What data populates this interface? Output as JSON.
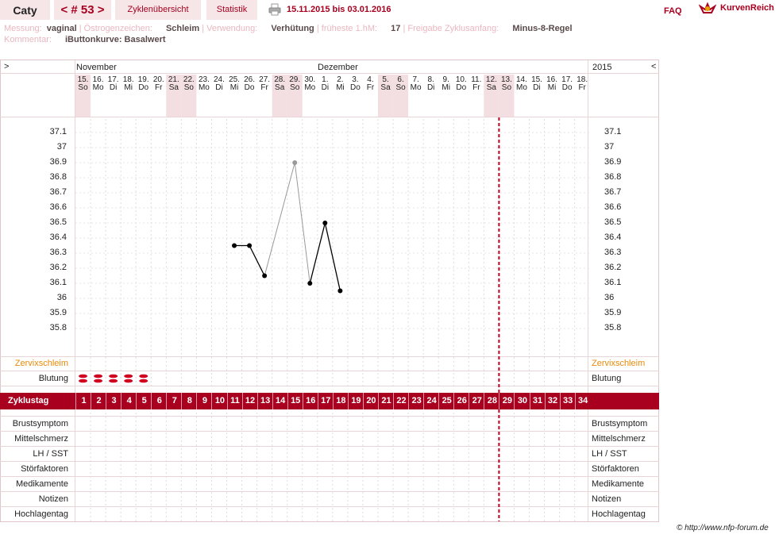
{
  "topbar": {
    "name": "Caty",
    "cycle_label": "< # 53 >",
    "tab_overview": "Zyklenübersicht",
    "tab_stats": "Statistik",
    "date_range": "15.11.2015 bis 03.01.2016",
    "faq": "FAQ",
    "logo": "KurvenReich"
  },
  "meta": {
    "messung_label": "Messung:",
    "messung_value": "vaginal",
    "oestrogen_label": "Östrogenzeichen:",
    "oestrogen_value": "Schleim",
    "verwendung_label": "Verwendung:",
    "verwendung_value": "Verhütung",
    "fruehste_label": "früheste 1.hM:",
    "fruehste_value": "17",
    "freigabe_label": "Freigabe Zyklusanfang:",
    "freigabe_value": "Minus-8-Regel",
    "kommentar_label": "Kommentar:",
    "kommentar_value": "iButtonkurve: Basalwert"
  },
  "chart": {
    "nav_left": ">",
    "nav_right": "<",
    "month_nov": "November",
    "month_dec": "Dezember",
    "year": "2015",
    "zervix_label": "Zervixschleim",
    "blutung_label": "Blutung",
    "zyklustag_label": "Zyklustag",
    "row_labels": [
      "Brustsymptom",
      "Mittelschmerz",
      "LH / SST",
      "Störfaktoren",
      "Medikamente",
      "Notizen",
      "Hochlagentag"
    ],
    "footer_credit": "© http://www.nfp-forum.de",
    "colors": {
      "accent": "#a8001e",
      "weekend": "#f3dfe2",
      "zervix": "#e98a0a",
      "coverline": "#c0001e"
    }
  },
  "chart_data": {
    "type": "line",
    "title": "",
    "ylabel": "",
    "ylim": [
      35.75,
      37.15
    ],
    "yticks": [
      "37.1",
      "37",
      "36.9",
      "36.8",
      "36.7",
      "36.6",
      "36.5",
      "36.4",
      "36.3",
      "36.2",
      "36.1",
      "36",
      "35.9",
      "35.8"
    ],
    "days": [
      {
        "d": "15.",
        "w": "So",
        "we": true
      },
      {
        "d": "16.",
        "w": "Mo"
      },
      {
        "d": "17.",
        "w": "Di"
      },
      {
        "d": "18.",
        "w": "Mi"
      },
      {
        "d": "19.",
        "w": "Do"
      },
      {
        "d": "20.",
        "w": "Fr"
      },
      {
        "d": "21.",
        "w": "Sa",
        "we": true
      },
      {
        "d": "22.",
        "w": "So",
        "we": true
      },
      {
        "d": "23.",
        "w": "Mo"
      },
      {
        "d": "24.",
        "w": "Di"
      },
      {
        "d": "25.",
        "w": "Mi"
      },
      {
        "d": "26.",
        "w": "Do"
      },
      {
        "d": "27.",
        "w": "Fr"
      },
      {
        "d": "28.",
        "w": "Sa",
        "we": true
      },
      {
        "d": "29.",
        "w": "So",
        "we": true
      },
      {
        "d": "30.",
        "w": "Mo"
      },
      {
        "d": "1.",
        "w": "Di"
      },
      {
        "d": "2.",
        "w": "Mi"
      },
      {
        "d": "3.",
        "w": "Do"
      },
      {
        "d": "4.",
        "w": "Fr"
      },
      {
        "d": "5.",
        "w": "Sa",
        "we": true
      },
      {
        "d": "6.",
        "w": "So",
        "we": true
      },
      {
        "d": "7.",
        "w": "Mo"
      },
      {
        "d": "8.",
        "w": "Di"
      },
      {
        "d": "9.",
        "w": "Mi"
      },
      {
        "d": "10.",
        "w": "Do"
      },
      {
        "d": "11.",
        "w": "Fr"
      },
      {
        "d": "12.",
        "w": "Sa",
        "we": true
      },
      {
        "d": "13.",
        "w": "So",
        "we": true
      },
      {
        "d": "14.",
        "w": "Mo"
      },
      {
        "d": "15.",
        "w": "Di"
      },
      {
        "d": "16.",
        "w": "Mi"
      },
      {
        "d": "17.",
        "w": "Do"
      },
      {
        "d": "18.",
        "w": "Fr"
      }
    ],
    "cycle_days": [
      1,
      2,
      3,
      4,
      5,
      6,
      7,
      8,
      9,
      10,
      11,
      12,
      13,
      14,
      15,
      16,
      17,
      18,
      19,
      20,
      21,
      22,
      23,
      24,
      25,
      26,
      27,
      28,
      29,
      30,
      31,
      32,
      33,
      34
    ],
    "series": [
      {
        "values": [
          [
            11,
            36.35
          ],
          [
            12,
            36.35
          ],
          [
            13,
            36.15
          ]
        ],
        "style": "solid"
      },
      {
        "values": [
          [
            13,
            36.15
          ],
          [
            15,
            36.9
          ],
          [
            16,
            36.1
          ]
        ],
        "style": "grey"
      },
      {
        "values": [
          [
            16,
            36.1
          ],
          [
            17,
            36.5
          ],
          [
            18,
            36.05
          ]
        ],
        "style": "solid"
      }
    ],
    "bleeding_days": [
      1,
      2,
      3,
      4,
      5
    ],
    "coverline_day": 28
  }
}
